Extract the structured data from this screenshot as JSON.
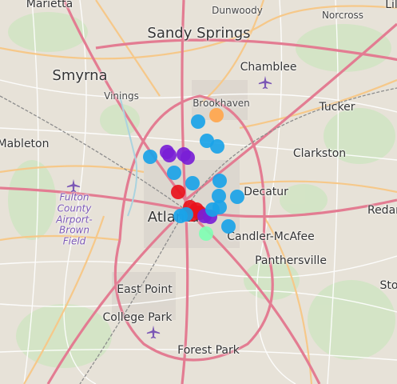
{
  "map": {
    "places": [
      {
        "name": "Marietta",
        "size": "mid"
      },
      {
        "name": "Dunwoody",
        "size": "sml"
      },
      {
        "name": "Norcross",
        "size": "sml"
      },
      {
        "name": "Sandy Springs",
        "size": "big"
      },
      {
        "name": "Chamblee",
        "size": "mid"
      },
      {
        "name": "Smyrna",
        "size": "big"
      },
      {
        "name": "Vinings",
        "size": "sml"
      },
      {
        "name": "Brookhaven",
        "size": "sml"
      },
      {
        "name": "Tucker",
        "size": "mid"
      },
      {
        "name": "Mableton",
        "size": "mid"
      },
      {
        "name": "Clarkston",
        "size": "mid"
      },
      {
        "name": "Decatur",
        "size": "mid"
      },
      {
        "name": "Redan",
        "size": "mid"
      },
      {
        "name": "Atlanta",
        "size": "big"
      },
      {
        "name": "Candler-McAfee",
        "size": "mid"
      },
      {
        "name": "Panthersville",
        "size": "mid"
      },
      {
        "name": "East Point",
        "size": "mid"
      },
      {
        "name": "Sto",
        "size": "mid"
      },
      {
        "name": "College Park",
        "size": "mid"
      },
      {
        "name": "Forest Park",
        "size": "mid"
      },
      {
        "name": "Lil",
        "size": "mid"
      }
    ],
    "airport_label": "Fulton\nCounty\nAirport-\nBrown\nField",
    "colors": {
      "blue": "#1aa3e8",
      "purple": "#7a1fd6",
      "red": "#e8141c",
      "orange": "#ffa64d",
      "green": "#80ffb4"
    },
    "markers": [
      {
        "color": "orange"
      },
      {
        "color": "blue"
      },
      {
        "color": "blue"
      },
      {
        "color": "blue"
      },
      {
        "color": "blue"
      },
      {
        "color": "purple"
      },
      {
        "color": "purple"
      },
      {
        "color": "purple"
      },
      {
        "color": "purple"
      },
      {
        "color": "blue"
      },
      {
        "color": "blue"
      },
      {
        "color": "red"
      },
      {
        "color": "blue"
      },
      {
        "color": "blue"
      },
      {
        "color": "blue"
      },
      {
        "color": "blue"
      },
      {
        "color": "red"
      },
      {
        "color": "red"
      },
      {
        "color": "red"
      },
      {
        "color": "red"
      },
      {
        "color": "purple"
      },
      {
        "color": "purple"
      },
      {
        "color": "blue"
      },
      {
        "color": "blue"
      },
      {
        "color": "green"
      },
      {
        "color": "blue"
      },
      {
        "color": "blue"
      }
    ]
  }
}
